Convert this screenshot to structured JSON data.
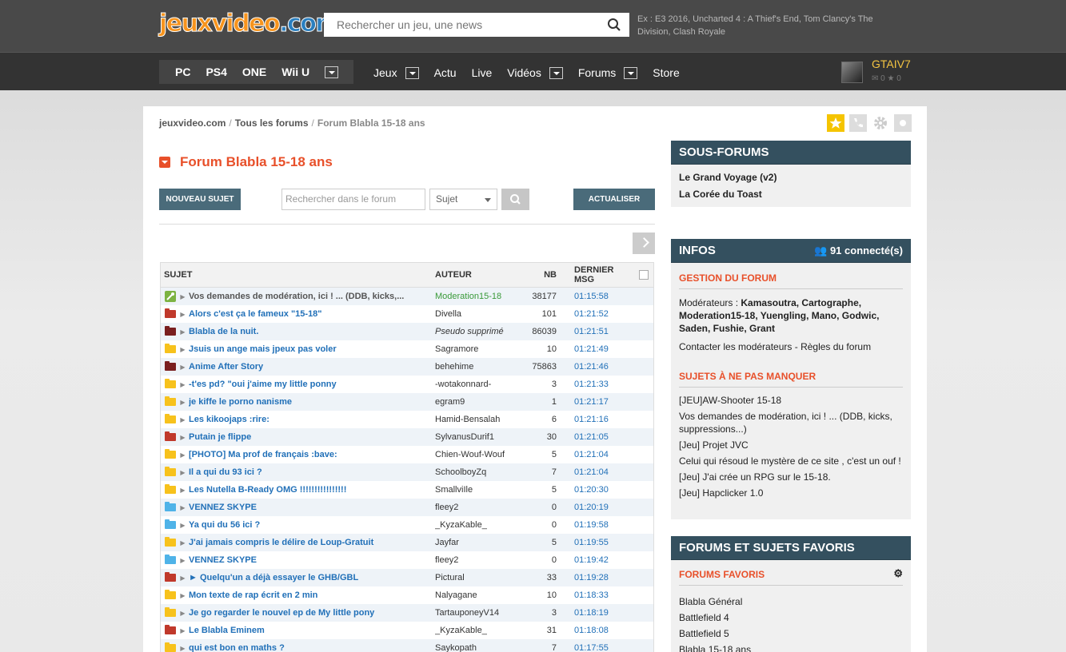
{
  "header": {
    "logo_a": "jeux",
    "logo_b": "video",
    "logo_c": ".com",
    "search_placeholder": "Rechercher un jeu, une news",
    "search_hint": "Ex : E3 2016, Uncharted 4 : A Thief's End, Tom Clancy's The Division, Clash Royale"
  },
  "nav": {
    "platforms": [
      "PC",
      "PS4",
      "ONE",
      "Wii U"
    ],
    "menu": [
      {
        "label": "Jeux",
        "dropdown": true
      },
      {
        "label": "Actu",
        "dropdown": false
      },
      {
        "label": "Live",
        "dropdown": false
      },
      {
        "label": "Vidéos",
        "dropdown": true
      },
      {
        "label": "Forums",
        "dropdown": true
      },
      {
        "label": "Store",
        "dropdown": false
      }
    ],
    "user": {
      "name": "GTAIV7",
      "messages": "0",
      "stars": "0"
    }
  },
  "breadcrumb": [
    "jeuxvideo.com",
    "Tous les forums",
    "Forum Blabla 15-18 ans"
  ],
  "forum": {
    "title": "Forum Blabla 15-18 ans",
    "new_topic": "NOUVEAU SUJET",
    "search_placeholder": "Rechercher dans le forum",
    "search_scope": "Sujet",
    "refresh": "ACTUALISER"
  },
  "table": {
    "headers": {
      "subject": "SUJET",
      "author": "AUTEUR",
      "nb": "NB",
      "last": "DERNIER MSG"
    },
    "rows": [
      {
        "icon": "pin",
        "subject": "Vos demandes de modération, ici ! ... (DDB, kicks,...",
        "author": "Moderation15-18",
        "author_style": "mod",
        "nb": "38177",
        "last": "01:15:58"
      },
      {
        "icon": "red",
        "subject": "Alors c'est ça le fameux \"15-18\"",
        "author": "Divella",
        "author_style": "",
        "nb": "101",
        "last": "01:21:52"
      },
      {
        "icon": "dark",
        "subject": "Blabla de la nuit.",
        "author": "Pseudo supprimé",
        "author_style": "deleted",
        "nb": "86039",
        "last": "01:21:51"
      },
      {
        "icon": "yellow",
        "subject": "Jsuis un ange mais jpeux pas voler",
        "author": "Sagramore",
        "author_style": "",
        "nb": "10",
        "last": "01:21:49"
      },
      {
        "icon": "dark",
        "subject": "Anime After Story",
        "author": "behehime",
        "author_style": "",
        "nb": "75863",
        "last": "01:21:46"
      },
      {
        "icon": "yellow",
        "subject": "-t'es pd? \"oui j'aime my little ponny",
        "author": "-wotakonnard-",
        "author_style": "",
        "nb": "3",
        "last": "01:21:33"
      },
      {
        "icon": "yellow",
        "subject": "je kiffe le porno nanisme",
        "author": "egram9",
        "author_style": "",
        "nb": "1",
        "last": "01:21:17"
      },
      {
        "icon": "yellow",
        "subject": "Les kikoojaps :rire:",
        "author": "Hamid-Bensalah",
        "author_style": "",
        "nb": "6",
        "last": "01:21:16"
      },
      {
        "icon": "red",
        "subject": "Putain je flippe",
        "author": "SylvanusDurif1",
        "author_style": "",
        "nb": "30",
        "last": "01:21:05"
      },
      {
        "icon": "yellow",
        "subject": "[PHOTO] Ma prof de français :bave:",
        "author": "Chien-Wouf-Wouf",
        "author_style": "",
        "nb": "5",
        "last": "01:21:04"
      },
      {
        "icon": "yellow",
        "subject": "Il a qui du 93 ici ?",
        "author": "SchoolboyZq",
        "author_style": "",
        "nb": "7",
        "last": "01:21:04"
      },
      {
        "icon": "yellow",
        "subject": "Les Nutella B-Ready OMG !!!!!!!!!!!!!!!!",
        "author": "SmallviIle",
        "author_style": "",
        "nb": "5",
        "last": "01:20:30"
      },
      {
        "icon": "blue",
        "subject": "VENNEZ SKYPE",
        "author": "fleey2",
        "author_style": "",
        "nb": "0",
        "last": "01:20:19"
      },
      {
        "icon": "blue",
        "subject": "Ya qui du 56 ici ?",
        "author": "_KyzaKable_",
        "author_style": "",
        "nb": "0",
        "last": "01:19:58"
      },
      {
        "icon": "yellow",
        "subject": "J'ai jamais compris le délire de Loup-Gratuit",
        "author": "Jayfar",
        "author_style": "",
        "nb": "5",
        "last": "01:19:55"
      },
      {
        "icon": "blue",
        "subject": "VENNEZ SKYPE",
        "author": "fleey2",
        "author_style": "",
        "nb": "0",
        "last": "01:19:42"
      },
      {
        "icon": "red",
        "subject": "► Quelqu'un a déjà essayer le GHB/GBL",
        "author": "Pictural",
        "author_style": "",
        "nb": "33",
        "last": "01:19:28"
      },
      {
        "icon": "yellow",
        "subject": "Mon texte de rap écrit en 2 min",
        "author": "Nalyagane",
        "author_style": "",
        "nb": "10",
        "last": "01:18:33"
      },
      {
        "icon": "yellow",
        "subject": "Je go regarder le nouvel ep de My little pony",
        "author": "TartauponeyV14",
        "author_style": "",
        "nb": "3",
        "last": "01:18:19"
      },
      {
        "icon": "red",
        "subject": "Le Blabla Eminem",
        "author": "_KyzaKable_",
        "author_style": "",
        "nb": "31",
        "last": "01:18:08"
      },
      {
        "icon": "yellow",
        "subject": "qui est bon en maths ?",
        "author": "Saykopath",
        "author_style": "",
        "nb": "7",
        "last": "01:17:55"
      }
    ]
  },
  "sidebar": {
    "subforums": {
      "title": "SOUS-FORUMS",
      "items": [
        "Le Grand Voyage (v2)",
        "La Corée du Toast"
      ]
    },
    "infos": {
      "title": "INFOS",
      "connected": "91 connecté(s)",
      "gestion_title": "GESTION DU FORUM",
      "mods_label": "Modérateurs :",
      "mods": "Kamasoutra, Cartographe, Moderation15-18, Yuengling, Mano, Godwic, Saden, Fushie, Grant",
      "contact": "Contacter les modérateurs - Règles du forum",
      "must_title": "SUJETS À NE PAS MANQUER",
      "must": [
        "[JEU]AW-Shooter 15-18",
        "Vos demandes de modération, ici ! ... (DDB, kicks, suppressions...)",
        "[Jeu] Projet JVC",
        "Celui qui résoud le mystère de ce site , c'est un ouf !",
        "[Jeu] J'ai crée un RPG sur le 15-18.",
        "[Jeu] Hapclicker 1.0"
      ]
    },
    "favs": {
      "title": "FORUMS ET SUJETS FAVORIS",
      "sub_title": "FORUMS FAVORIS",
      "items": [
        "Blabla Général",
        "Battlefield 4",
        "Battlefield 5",
        "Blabla 15-18 ans"
      ]
    }
  },
  "colors": {
    "accent": "#e8502a",
    "header": "#34505f",
    "link": "#2170b8"
  }
}
